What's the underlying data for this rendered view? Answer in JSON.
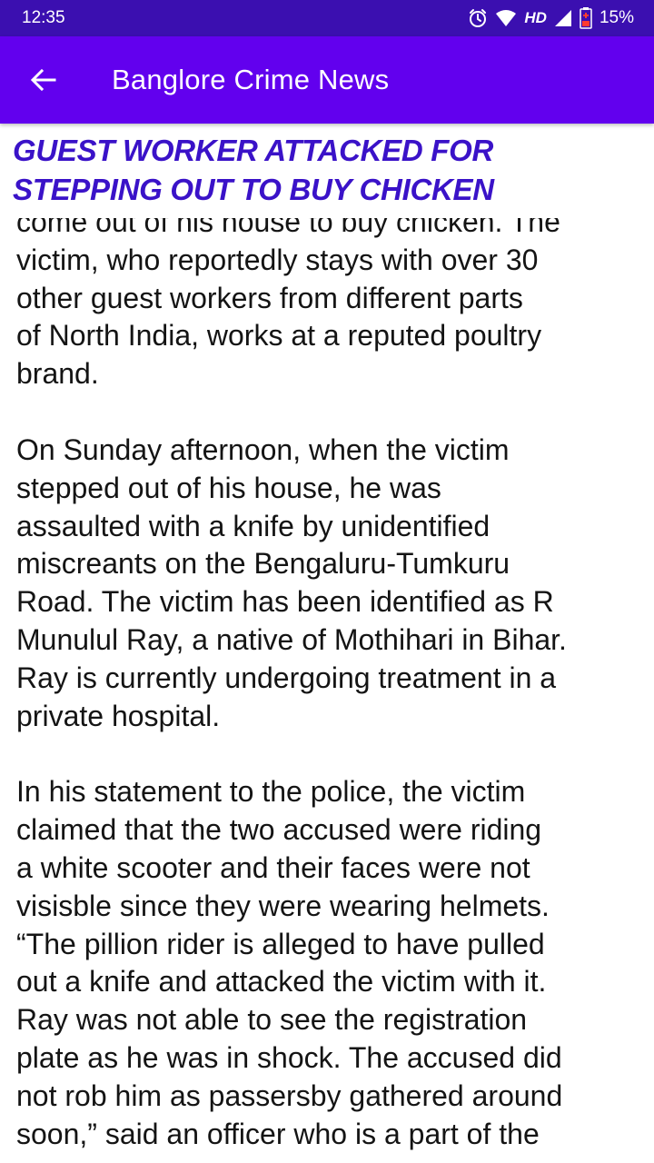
{
  "status_bar": {
    "time": "12:35",
    "network": "HD",
    "battery": "15%",
    "icons": [
      "alarm-icon",
      "wifi-icon",
      "signal-icon",
      "battery-low-icon"
    ]
  },
  "app_bar": {
    "title": "Banglore Crime News",
    "back_icon": "arrow-left-icon",
    "color": "#6200ee"
  },
  "article": {
    "headline": "GUEST WORKER ATTACKED FOR STEPPING OUT TO BUY CHICKEN",
    "headline_color": "#3a12c8",
    "paragraphs": [
      "come out of his house to buy chicken. The\nvictim, who reportedly stays with over 30\nother guest workers from different parts\nof North India, works at a reputed poultry\nbrand.",
      "On Sunday afternoon, when the victim\nstepped out of his house, he was\nassaulted with a knife by unidentified\nmiscreants on the Bengaluru-Tumkuru\nRoad. The victim has been identified as R\nMunulul Ray, a native of Mothihari in Bihar.\nRay is currently undergoing treatment in a\nprivate hospital.",
      "In his statement to the police, the victim\nclaimed that the two accused were riding\na white scooter and their faces were not\nvisisble since they were wearing helmets.\n“The pillion rider is alleged to have pulled\nout a knife and attacked the victim with it.\nRay was not able to see the registration\nplate as he was in shock. The accused did\nnot rob him as passersby gathered around\nsoon,” said an officer who is a part of the"
    ]
  }
}
